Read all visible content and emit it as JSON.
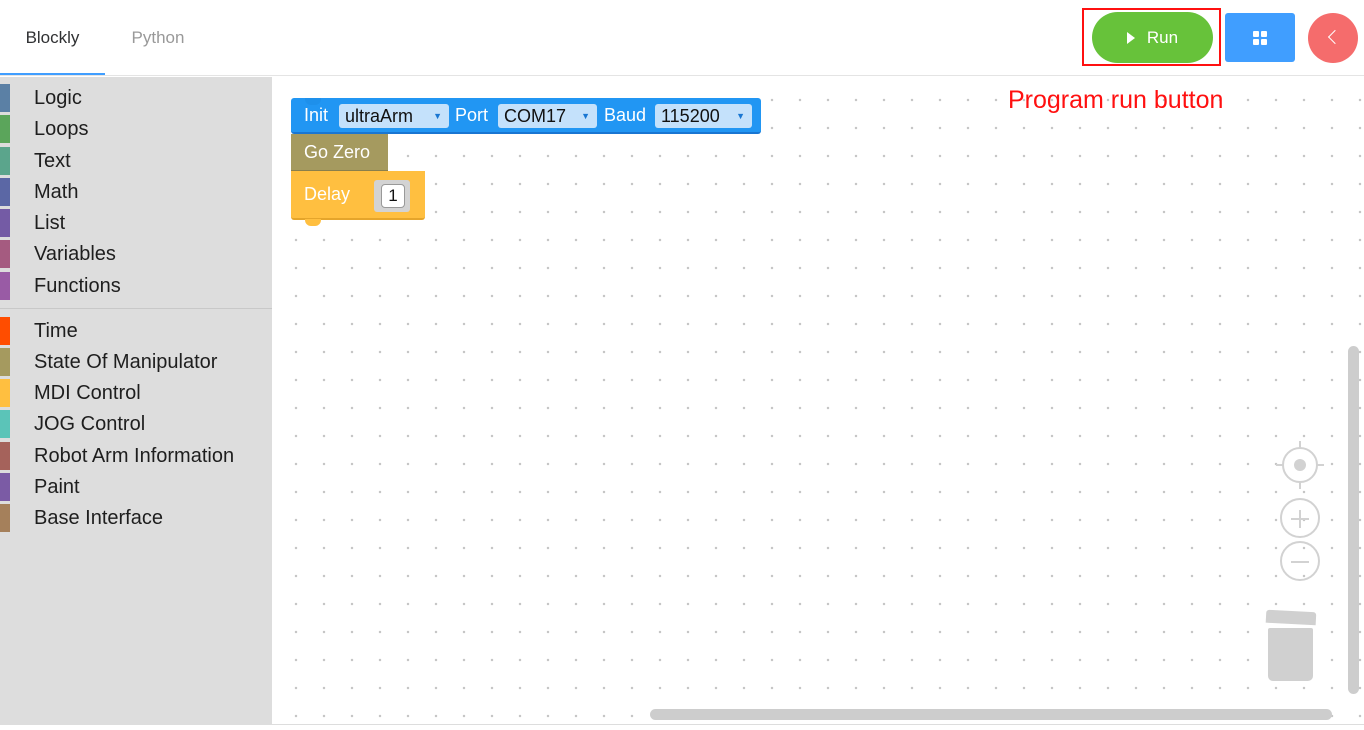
{
  "tabs": [
    {
      "label": "Blockly",
      "active": true
    },
    {
      "label": "Python",
      "active": false
    }
  ],
  "toolbar": {
    "run_label": "Run",
    "run_icon": "play-icon",
    "grid_icon": "grid-icon",
    "back_icon": "chevron-left-icon"
  },
  "toolbox": {
    "groups": [
      [
        {
          "label": "Logic",
          "color": "#5b80a5"
        },
        {
          "label": "Loops",
          "color": "#5ba55b"
        },
        {
          "label": "Text",
          "color": "#5ba58c"
        },
        {
          "label": "Math",
          "color": "#5b67a5"
        },
        {
          "label": "List",
          "color": "#745ba5"
        },
        {
          "label": "Variables",
          "color": "#a55b80"
        },
        {
          "label": "Functions",
          "color": "#995ba5"
        }
      ],
      [
        {
          "label": "Time",
          "color": "#ff4d00"
        },
        {
          "label": "State Of Manipulator",
          "color": "#a59a5f"
        },
        {
          "label": "MDI Control",
          "color": "#ffbf40"
        },
        {
          "label": "JOG Control",
          "color": "#5bc4b8"
        },
        {
          "label": "Robot Arm Information",
          "color": "#a5625b"
        },
        {
          "label": "Paint",
          "color": "#7b5ba5"
        },
        {
          "label": "Base Interface",
          "color": "#a5805b"
        }
      ]
    ]
  },
  "blocks": {
    "init": {
      "label_init": "Init",
      "device": "ultraArm",
      "label_port": "Port",
      "port": "COM17",
      "label_baud": "Baud",
      "baud": "115200",
      "color": "#2196f3"
    },
    "go_zero": {
      "label": "Go Zero",
      "color": "#a59a5f"
    },
    "delay": {
      "label": "Delay",
      "value": "1",
      "color": "#ffbf40"
    }
  },
  "workspace_controls": {
    "recenter_icon": "crosshair-icon",
    "zoom_in_icon": "zoom-in-icon",
    "zoom_out_icon": "zoom-out-icon",
    "trash_icon": "trash-icon"
  },
  "annotation": {
    "text": "Program run button",
    "color": "#ff1010"
  }
}
